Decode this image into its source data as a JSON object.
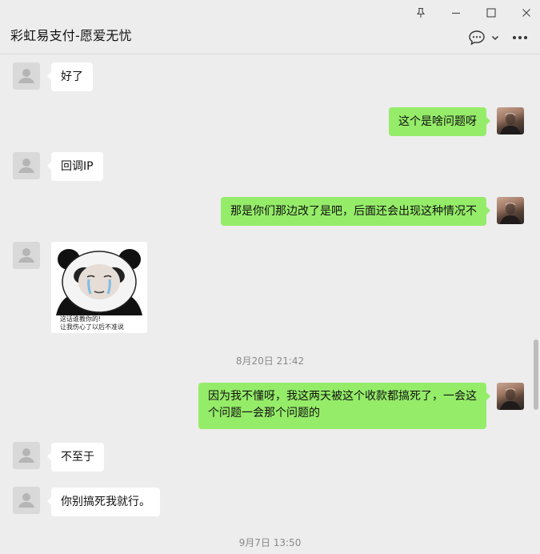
{
  "window": {
    "title": "彩虹易支付-愿爱无忧"
  },
  "icons": {
    "pin": "pin-icon",
    "minimize": "minimize-icon",
    "maximize": "maximize-icon",
    "close": "close-icon",
    "chat_info": "chat-bubble-icon",
    "dropdown": "chevron-down-icon",
    "more": "more-icon",
    "default_avatar": "person-icon"
  },
  "colors": {
    "background": "#ededed",
    "own_bubble": "#95ec69",
    "other_bubble": "#ffffff"
  },
  "messages": {
    "m1": "好了",
    "m2": "这个是啥问题呀",
    "m3": "回调IP",
    "m4": "那是你们那边改了是吧，后面还会出现这种情况不",
    "m5_sticker": {
      "line1": "这话谁教你的!",
      "line2": "让我伤心了以后不准说"
    },
    "ts1": "8月20日 21:42",
    "m6": "因为我不懂呀，我这两天被这个收款都搞死了，一会这个问题一会那个问题的",
    "m7": "不至于",
    "m8": "你别搞死我就行。",
    "ts2": "9月7日 13:50"
  }
}
